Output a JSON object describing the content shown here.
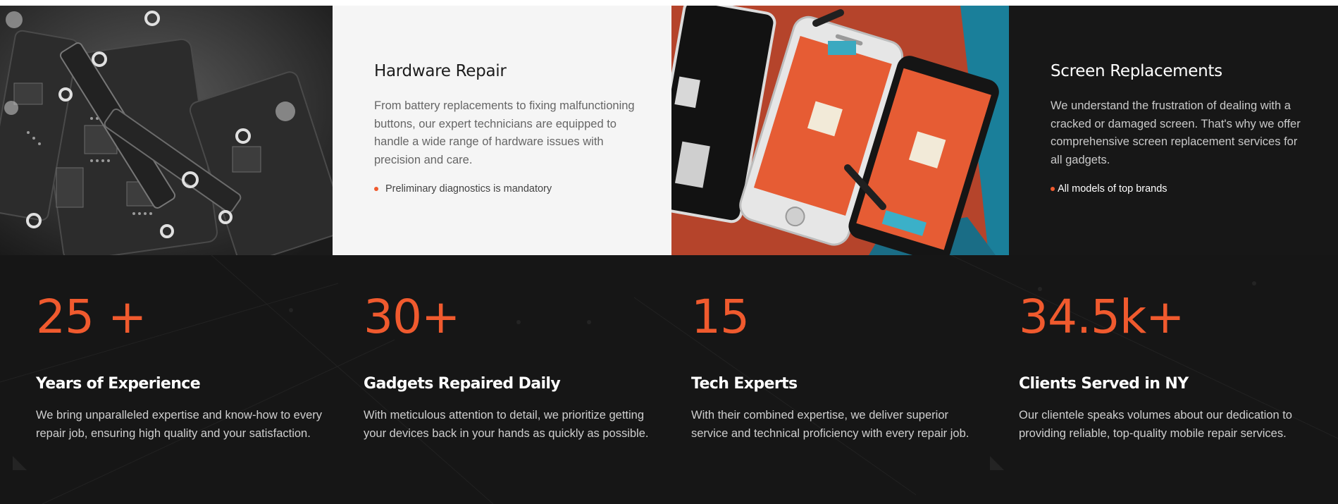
{
  "services": [
    {
      "title": "Hardware Repair",
      "description": "From battery replacements to fixing malfunctioning buttons, our expert technicians are equipped to handle a wide range of hardware issues with precision and care.",
      "bullet": "Preliminary diagnostics is mandatory"
    },
    {
      "title": "Screen Replacements",
      "description": "We understand the frustration of dealing with a cracked or damaged screen. That's why we offer comprehensive screen replacement services for all gadgets.",
      "bullet": "All models of top brands"
    }
  ],
  "stats": [
    {
      "number": "25 +",
      "title": "Years of Experience",
      "description": "We bring unparalleled expertise and know-how to every repair job, ensuring high quality and your satisfaction."
    },
    {
      "number": "30+",
      "title": "Gadgets Repaired Daily",
      "description": "With meticulous attention to detail, we prioritize getting your devices back in your hands as quickly as possible."
    },
    {
      "number": "15",
      "title": "Tech Experts",
      "description": "With their combined expertise, we deliver superior service and technical proficiency with every repair job."
    },
    {
      "number": "34.5k+",
      "title": "Clients Served in NY",
      "description": "Our clientele speaks volumes about our dedication to providing reliable, top-quality mobile repair services."
    }
  ],
  "colors": {
    "accent": "#f05a2e",
    "dark_background": "#161616",
    "light_background": "#f5f5f5"
  },
  "images": {
    "left": "circuit-board-photo",
    "right": "phone-screen-parts-photo"
  }
}
